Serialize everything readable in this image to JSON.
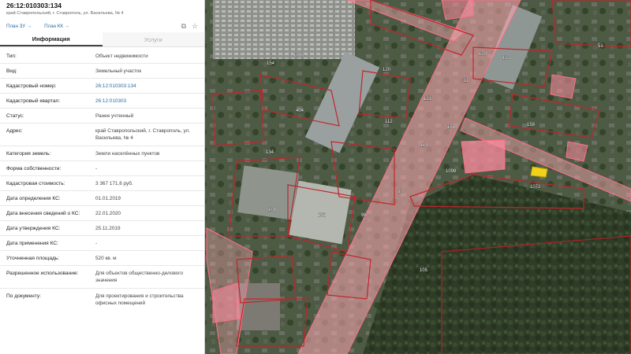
{
  "header": {
    "cadastral_number": "26:12:010303:134",
    "address_short": "край Ставропольский, г. Ставрополь, ул. Васильева, № 4",
    "close_icon": "close-icon"
  },
  "links": {
    "plan_zu": "План ЗУ →",
    "plan_kk": "План КК →",
    "tool_icons": [
      "copy-icon",
      "star-icon"
    ]
  },
  "tabs": [
    {
      "label": "Информация",
      "active": true
    },
    {
      "label": "Услуги",
      "active": false
    }
  ],
  "rows": [
    {
      "key": "Тип:",
      "value": "Объект недвижимости"
    },
    {
      "key": "Вид:",
      "value": "Земельный участок"
    },
    {
      "key": "Кадастровый номер:",
      "value": "26:12:010303:134",
      "link": true
    },
    {
      "key": "Кадастровый квартал:",
      "value": "26:12:010303",
      "link": true
    },
    {
      "key": "Статус:",
      "value": "Ранее учтенный"
    },
    {
      "key": "Адрес:",
      "value": "край Ставропольский, г. Ставрополь, ул. Васильева, № 4"
    },
    {
      "key": "Категория земель:",
      "value": "Земли населённых пунктов"
    },
    {
      "key": "Форма собственности:",
      "value": "-"
    },
    {
      "key": "Кадастровая стоимость:",
      "value": "3 367 171,6 руб."
    },
    {
      "key": "Дата определения КС:",
      "value": "01.01.2019"
    },
    {
      "key": "Дата внесения сведений о КС:",
      "value": "22.01.2020"
    },
    {
      "key": "Дата утверждения КС:",
      "value": "25.11.2019"
    },
    {
      "key": "Дата применения КС:",
      "value": "-"
    },
    {
      "key": "Уточненная площадь:",
      "value": "520 кв. м"
    },
    {
      "key": "Разрешенное использование:",
      "value": "Для объектов общественно-делового значения"
    },
    {
      "key": "По документу:",
      "value": "Для проектирования и строительства офисных помещений"
    }
  ],
  "map_labels": [
    "1020",
    "154",
    "120",
    "121",
    "404",
    "112",
    "119",
    "134",
    "132",
    "105",
    "1072",
    "1098",
    "137",
    "11",
    "155",
    "139",
    "158",
    "96",
    "51",
    "105",
    "10"
  ],
  "colors": {
    "accent_link": "#2c6aa5",
    "parcel_fill": "rgba(255,170,180,0.55)",
    "parcel_stroke": "#ff6f86",
    "selected_parcel": "#f0d21a"
  }
}
